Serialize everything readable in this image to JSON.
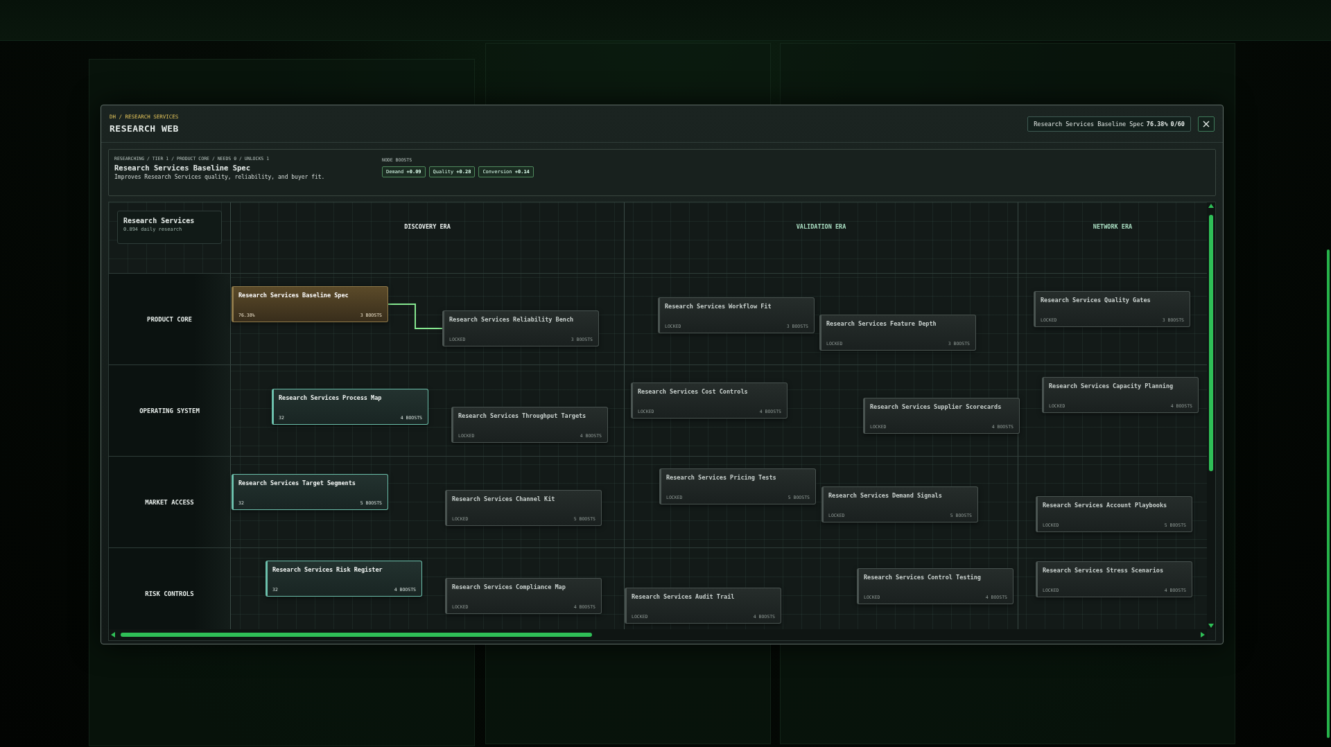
{
  "breadcrumb": "DH / RESEARCH SERVICES",
  "title": "RESEARCH WEB",
  "current": {
    "name": "Research Services Baseline Spec",
    "progress": "76.38%",
    "count": "0/60"
  },
  "detail": {
    "meta": "RESEARCHING / TIER 1 / PRODUCT CORE / NEEDS 0 / UNLOCKS 1",
    "name": "Research Services Baseline Spec",
    "description": "Improves Research Services quality, reliability, and buyer fit.",
    "boosts_label": "NODE BOOSTS",
    "boosts": [
      "Demand **+0.09**",
      "Quality **+0.28**",
      "Conversion **+0.14**"
    ]
  },
  "branch": {
    "name": "Research Services",
    "rate": "0.894 daily research"
  },
  "eras": [
    "DISCOVERY ERA",
    "VALIDATION ERA",
    "NETWORK ERA"
  ],
  "lanes": [
    {
      "name": "PRODUCT CORE",
      "nodes": [
        {
          "name": "Research Services Baseline Spec",
          "kind": "researching",
          "footer": "76.38%",
          "boosts": "3 BOOSTS",
          "links_next": true
        },
        {
          "name": "Research Services Reliability Bench",
          "kind": "locked",
          "footer": "LOCKED",
          "boosts": "3 BOOSTS"
        },
        {
          "name": "Research Services Workflow Fit",
          "kind": "locked",
          "footer": "LOCKED",
          "boosts": "3 BOOSTS"
        },
        {
          "name": "Research Services Feature Depth",
          "kind": "locked",
          "footer": "LOCKED",
          "boosts": "3 BOOSTS"
        },
        {
          "name": "Research Services Quality Gates",
          "kind": "locked",
          "footer": "LOCKED",
          "boosts": "3 BOOSTS"
        }
      ]
    },
    {
      "name": "OPERATING SYSTEM",
      "nodes": [
        {
          "name": "Research Services Process Map",
          "kind": "available",
          "footer": "32",
          "boosts": "4 BOOSTS"
        },
        {
          "name": "Research Services Throughput Targets",
          "kind": "locked",
          "footer": "LOCKED",
          "boosts": "4 BOOSTS"
        },
        {
          "name": "Research Services Cost Controls",
          "kind": "locked",
          "footer": "LOCKED",
          "boosts": "4 BOOSTS"
        },
        {
          "name": "Research Services Supplier Scorecards",
          "kind": "locked",
          "footer": "LOCKED",
          "boosts": "4 BOOSTS"
        },
        {
          "name": "Research Services Capacity Planning",
          "kind": "locked",
          "footer": "LOCKED",
          "boosts": "4 BOOSTS"
        }
      ]
    },
    {
      "name": "MARKET ACCESS",
      "nodes": [
        {
          "name": "Research Services Target Segments",
          "kind": "available",
          "footer": "32",
          "boosts": "5 BOOSTS"
        },
        {
          "name": "Research Services Channel Kit",
          "kind": "locked",
          "footer": "LOCKED",
          "boosts": "5 BOOSTS"
        },
        {
          "name": "Research Services Pricing Tests",
          "kind": "locked",
          "footer": "LOCKED",
          "boosts": "5 BOOSTS"
        },
        {
          "name": "Research Services Demand Signals",
          "kind": "locked",
          "footer": "LOCKED",
          "boosts": "5 BOOSTS"
        },
        {
          "name": "Research Services Account Playbooks",
          "kind": "locked",
          "footer": "LOCKED",
          "boosts": "5 BOOSTS"
        }
      ]
    },
    {
      "name": "RISK CONTROLS",
      "nodes": [
        {
          "name": "Research Services Risk Register",
          "kind": "available",
          "footer": "32",
          "boosts": "4 BOOSTS"
        },
        {
          "name": "Research Services Compliance Map",
          "kind": "locked",
          "footer": "LOCKED",
          "boosts": "4 BOOSTS"
        },
        {
          "name": "Research Services Audit Trail",
          "kind": "locked",
          "footer": "LOCKED",
          "boosts": "4 BOOSTS"
        },
        {
          "name": "Research Services Control Testing",
          "kind": "locked",
          "footer": "LOCKED",
          "boosts": "4 BOOSTS"
        },
        {
          "name": "Research Services Stress Scenarios",
          "kind": "locked",
          "footer": "LOCKED",
          "boosts": "4 BOOSTS"
        }
      ]
    }
  ]
}
